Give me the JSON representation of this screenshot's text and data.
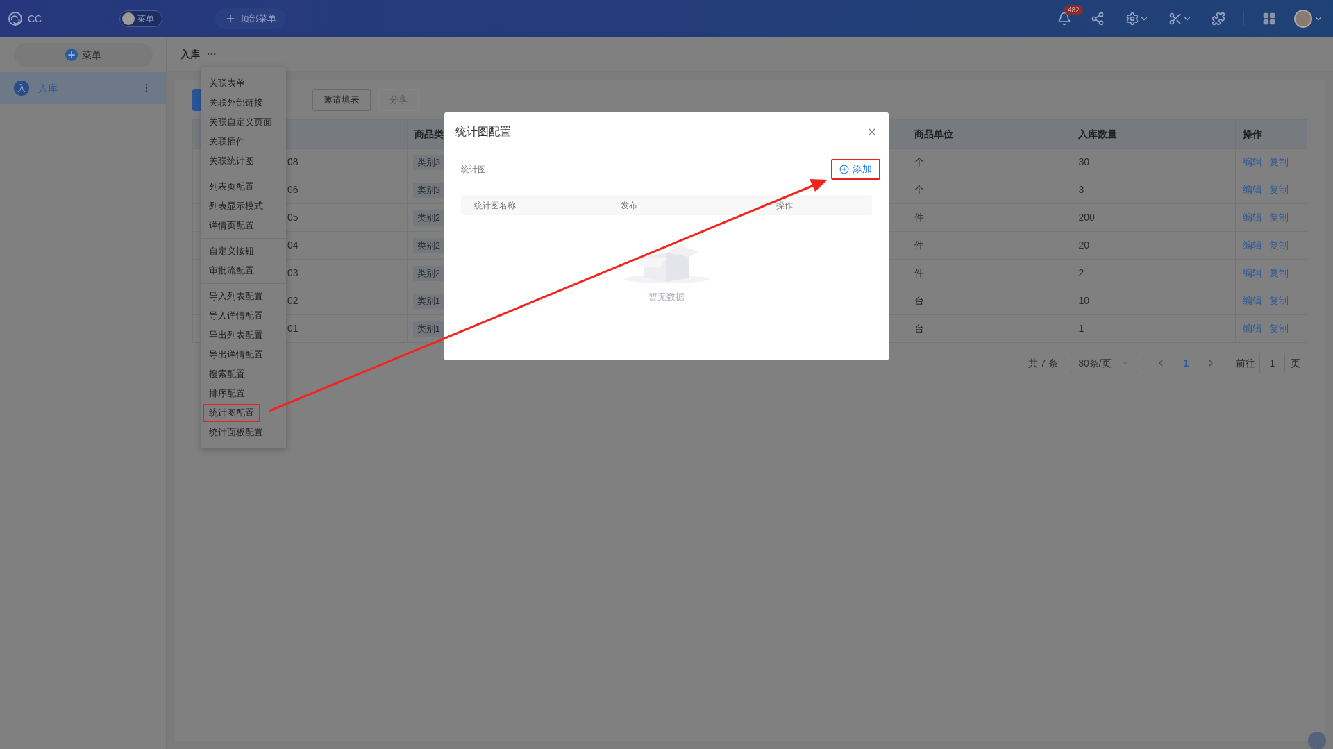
{
  "top_bar": {
    "logo_text": "CC",
    "menu_switch": {
      "label": "菜单",
      "on": false
    },
    "top_menu_button": "顶部菜单",
    "notification_count": "482"
  },
  "sidebar": {
    "add_button": "菜单",
    "items": [
      {
        "icon_text": "入",
        "label": "入库",
        "selected": true
      }
    ]
  },
  "breadcrumb": {
    "title": "入库",
    "more": "···"
  },
  "toolbar": {
    "buttons": [
      {
        "label": "邀请填表",
        "disabled": false
      },
      {
        "label": "分享",
        "disabled": true
      }
    ]
  },
  "table": {
    "columns": [
      "商品类",
      "商品单位",
      "入库数量",
      "操作"
    ],
    "rows": [
      {
        "column_1": "08",
        "column_2": "类别3",
        "unit": "个",
        "quantity": "30",
        "actions": [
          "编辑",
          "复制"
        ]
      },
      {
        "column_1": "06",
        "column_2": "类别3",
        "unit": "个",
        "quantity": "3",
        "actions": [
          "编辑",
          "复制"
        ]
      },
      {
        "column_1": "05",
        "column_2": "类别2",
        "unit": "件",
        "quantity": "200",
        "actions": [
          "编辑",
          "复制"
        ]
      },
      {
        "column_1": "04",
        "column_2": "类别2",
        "unit": "件",
        "quantity": "20",
        "actions": [
          "编辑",
          "复制"
        ]
      },
      {
        "column_1": "03",
        "column_2": "类别2",
        "unit": "件",
        "quantity": "2",
        "actions": [
          "编辑",
          "复制"
        ]
      },
      {
        "column_1": "02",
        "column_2": "类别1",
        "unit": "台",
        "quantity": "10",
        "actions": [
          "编辑",
          "复制"
        ]
      },
      {
        "column_1": "01",
        "column_2": "类别1",
        "unit": "台",
        "quantity": "1",
        "actions": [
          "编辑",
          "复制"
        ]
      }
    ]
  },
  "pagination": {
    "total": "共 7 条",
    "page_size": "30条/页",
    "pages": [
      {
        "label": "1",
        "selected": true
      }
    ],
    "goto_label": "前往",
    "goto_value": "1",
    "goto_suffix": "页"
  },
  "dropdown_menu": {
    "groups": [
      [
        {
          "label": "关联表单",
          "highlighted": false
        },
        {
          "label": "关联外部链接",
          "highlighted": false
        },
        {
          "label": "关联自定义页面",
          "highlighted": false
        },
        {
          "label": "关联插件",
          "highlighted": false
        },
        {
          "label": "关联统计图",
          "highlighted": false
        }
      ],
      [
        {
          "label": "列表页配置",
          "highlighted": false
        },
        {
          "label": "列表显示模式",
          "highlighted": false
        },
        {
          "label": "详情页配置",
          "highlighted": false
        }
      ],
      [
        {
          "label": "自定义按钮",
          "highlighted": false
        },
        {
          "label": "审批流配置",
          "highlighted": false
        }
      ],
      [
        {
          "label": "导入列表配置",
          "highlighted": false
        },
        {
          "label": "导入详情配置",
          "highlighted": false
        },
        {
          "label": "导出列表配置",
          "highlighted": false
        },
        {
          "label": "导出详情配置",
          "highlighted": false
        },
        {
          "label": "搜索配置",
          "highlighted": false
        },
        {
          "label": "排序配置",
          "highlighted": false
        },
        {
          "label": "统计图配置",
          "highlighted": true
        },
        {
          "label": "统计面板配置",
          "highlighted": false
        }
      ]
    ]
  },
  "dialog": {
    "title": "统计图配置",
    "section_label": "统计图",
    "add_button": {
      "label": "添加",
      "highlighted": true
    },
    "columns": [
      "统计图名称",
      "发布",
      "操作"
    ],
    "empty_text": "暂无数据"
  }
}
